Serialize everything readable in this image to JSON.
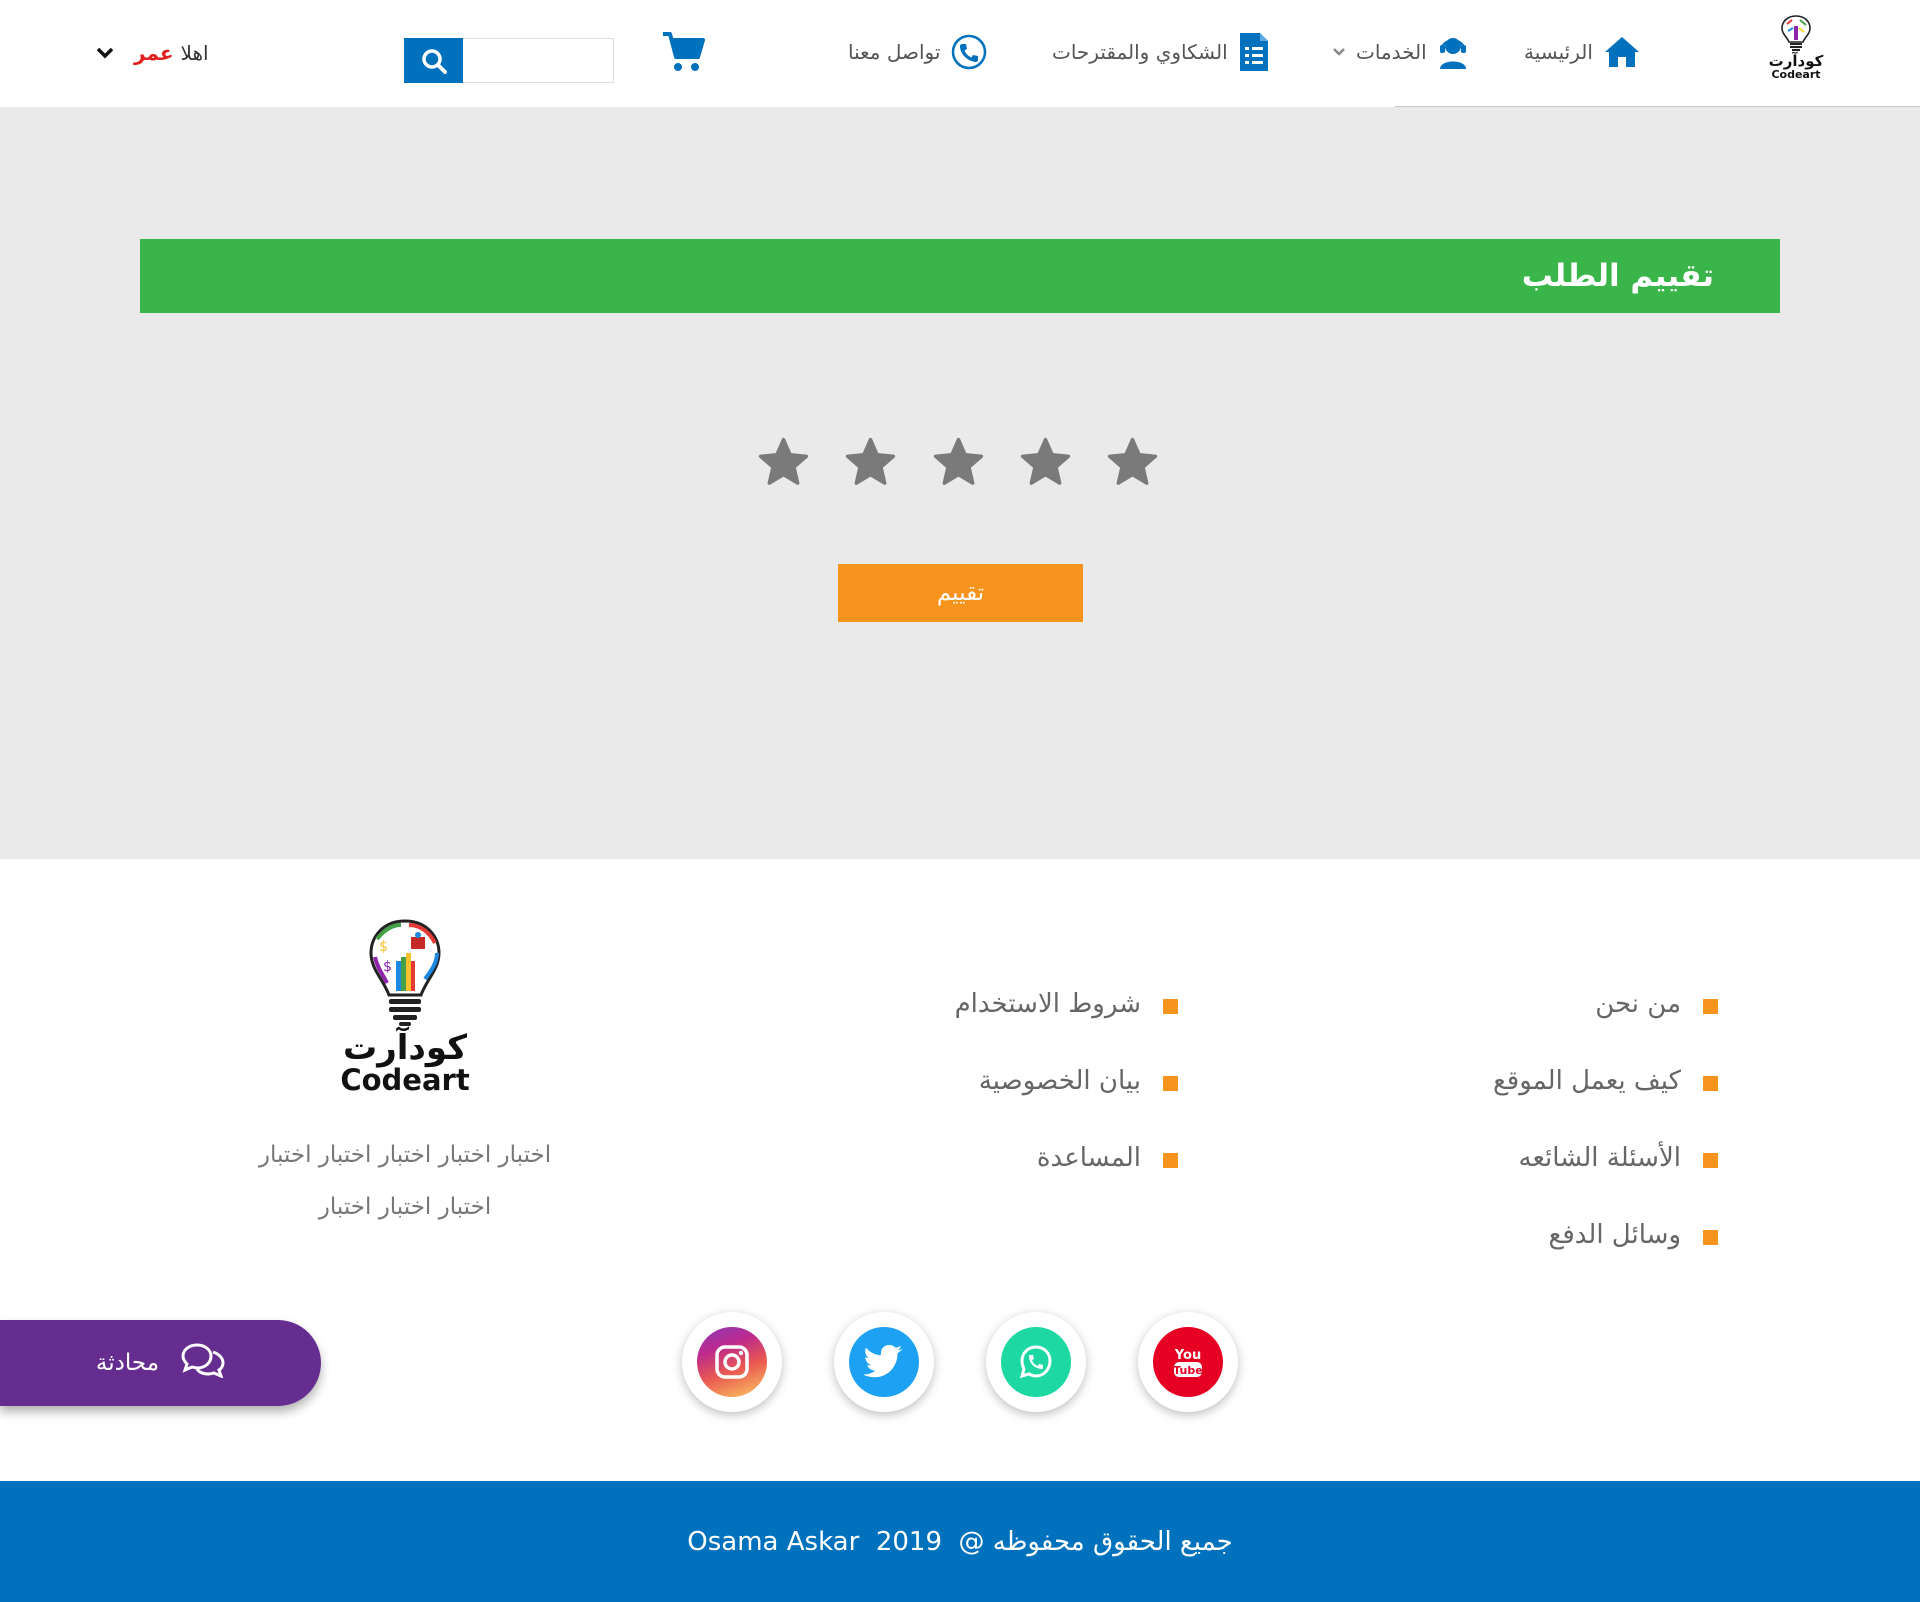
{
  "header": {
    "logo": {
      "arabic": "كودآرت",
      "english": "Codeart"
    },
    "nav": [
      {
        "label": "الرئيسية",
        "icon": "home-icon"
      },
      {
        "label": "الخدمات",
        "icon": "support-agent-icon"
      },
      {
        "label": "الشكاوي والمقترحات",
        "icon": "document-list-icon"
      },
      {
        "label": "تواصل معنا",
        "icon": "phone-icon"
      }
    ],
    "search": {
      "placeholder": "",
      "value": ""
    },
    "user": {
      "greeting": "اهلا",
      "name": "عمر"
    }
  },
  "main": {
    "title": "تقييم الطلب",
    "rating": {
      "max": 5,
      "value": 0
    },
    "rate_button": "تقييم"
  },
  "footer": {
    "links_col1": [
      "من نحن",
      "كيف يعمل الموقع",
      "الأسئلة الشائعه",
      "وسائل الدفع"
    ],
    "links_col2": [
      "شروط الاستخدام",
      "بيان الخصوصية",
      "المساعدة"
    ],
    "logo": {
      "arabic": "كودآرت",
      "english": "Codeart"
    },
    "about_line1": "اختبار اختبار اختبار اختبار اختبار",
    "about_line2": "اختبار اختبار اختبار",
    "social": [
      "youtube-icon",
      "whatsapp-icon",
      "twitter-icon",
      "instagram-icon"
    ],
    "chat_label": "محادثة",
    "copyright": "جميع الحقوق محفوظه @  2019  Osama Askar"
  },
  "colors": {
    "primary_blue": "#0071bc",
    "green": "#3ab54a",
    "orange": "#f7941e",
    "purple": "#662d91",
    "main_bg": "#eaeaea",
    "star_gray": "#7a7a7a",
    "user_name_red": "#e02020"
  }
}
